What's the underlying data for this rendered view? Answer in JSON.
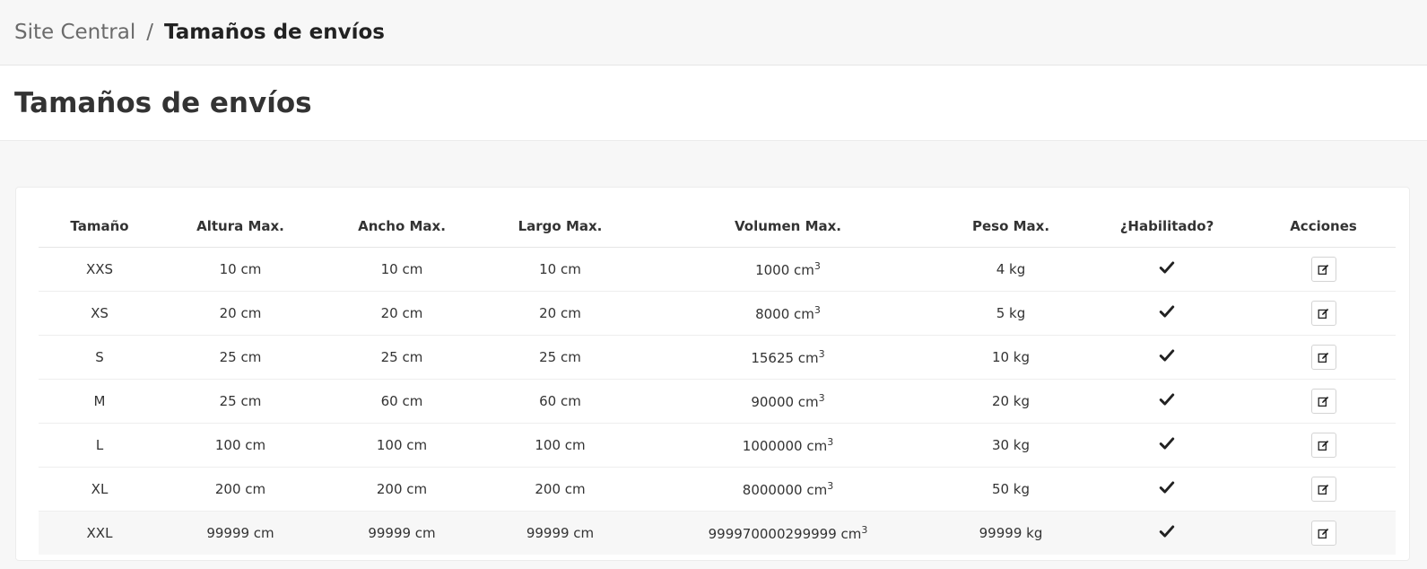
{
  "breadcrumb": {
    "root": "Site Central",
    "separator": "/",
    "current": "Tamaños de envíos"
  },
  "page": {
    "title": "Tamaños de envíos"
  },
  "table": {
    "headers": [
      "Tamaño",
      "Altura Max.",
      "Ancho Max.",
      "Largo Max.",
      "Volumen Max.",
      "Peso Max.",
      "¿Habilitado?",
      "Acciones"
    ],
    "rows": [
      {
        "size": "XXS",
        "height": "10 cm",
        "width": "10 cm",
        "length": "10 cm",
        "volume": "1000 cm",
        "volume_exp": "3",
        "weight": "4 kg",
        "enabled": true
      },
      {
        "size": "XS",
        "height": "20 cm",
        "width": "20 cm",
        "length": "20 cm",
        "volume": "8000 cm",
        "volume_exp": "3",
        "weight": "5 kg",
        "enabled": true
      },
      {
        "size": "S",
        "height": "25 cm",
        "width": "25 cm",
        "length": "25 cm",
        "volume": "15625 cm",
        "volume_exp": "3",
        "weight": "10 kg",
        "enabled": true
      },
      {
        "size": "M",
        "height": "25 cm",
        "width": "60 cm",
        "length": "60 cm",
        "volume": "90000 cm",
        "volume_exp": "3",
        "weight": "20 kg",
        "enabled": true
      },
      {
        "size": "L",
        "height": "100 cm",
        "width": "100 cm",
        "length": "100 cm",
        "volume": "1000000 cm",
        "volume_exp": "3",
        "weight": "30 kg",
        "enabled": true
      },
      {
        "size": "XL",
        "height": "200 cm",
        "width": "200 cm",
        "length": "200 cm",
        "volume": "8000000 cm",
        "volume_exp": "3",
        "weight": "50 kg",
        "enabled": true
      },
      {
        "size": "XXL",
        "height": "99999 cm",
        "width": "99999 cm",
        "length": "99999 cm",
        "volume": "999970000299999 cm",
        "volume_exp": "3",
        "weight": "99999 kg",
        "enabled": true
      }
    ]
  },
  "icons": {
    "enabled": "check-icon",
    "edit": "edit-icon"
  }
}
